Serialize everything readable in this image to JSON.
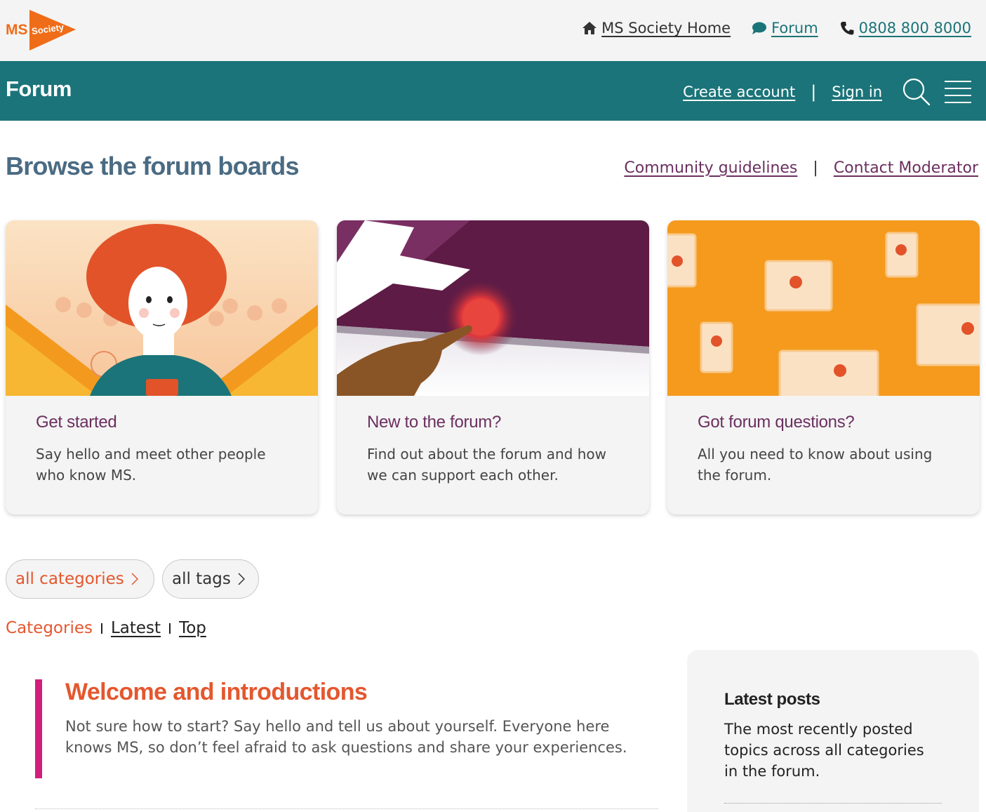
{
  "brand": {
    "logo_ms": "MS",
    "logo_society": "Society",
    "orange": "#ef6c18",
    "teal": "#1b7479",
    "plum": "#6b2f5f",
    "accent_red": "#e4572e",
    "category_bar": "#d21e7c"
  },
  "utility_nav": {
    "home_label": "MS Society Home",
    "home_icon": "home-icon",
    "forum_label": "Forum",
    "forum_icon": "speech-bubble-icon",
    "phone_label": " 0808 800 8000",
    "phone_icon": "phone-icon"
  },
  "forum_bar": {
    "title": "Forum",
    "create_account": "Create account",
    "separator": "|",
    "sign_in": "Sign in",
    "search_icon": "search-icon",
    "menu_icon": "hamburger-menu-icon"
  },
  "page": {
    "title": "Browse the forum boards",
    "community_guidelines": "Community guidelines",
    "separator": "|",
    "contact_moderator": "Contact Moderator"
  },
  "cards": [
    {
      "title": "Get started",
      "description": "Say hello and meet other people who know MS."
    },
    {
      "title": "New to the forum?",
      "description": "Find out about the forum and how we can support each other."
    },
    {
      "title": "Got forum questions?",
      "description": "All you need to know about using the forum."
    }
  ],
  "filters": {
    "categories": "all categories",
    "tags": "all tags",
    "chevron": "›"
  },
  "tabs": {
    "categories": "Categories",
    "latest": "Latest",
    "top": "Top"
  },
  "category": {
    "title": "Welcome and introductions",
    "description": "Not sure how to start? Say hello and tell us about yourself. Everyone here knows MS, so don’t feel afraid to ask questions and share your experiences."
  },
  "latest_posts": {
    "title": "Latest posts",
    "description": "The most recently posted topics across all categories in the forum."
  }
}
